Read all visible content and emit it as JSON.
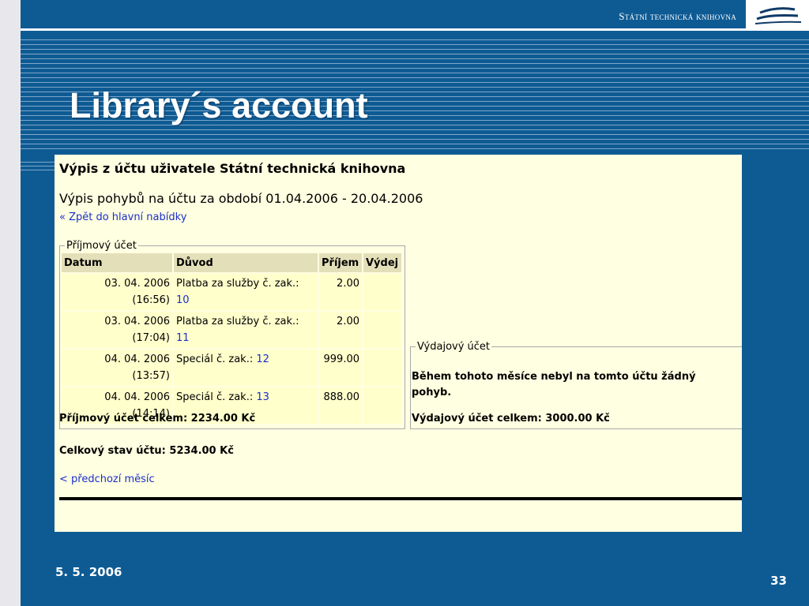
{
  "header": {
    "organization": "Státní technická knihovna",
    "logo": "stk-logo-icon"
  },
  "title": "Library´s account",
  "statement": {
    "heading": "Výpis z účtu uživatele Státní technická knihovna",
    "period": "Výpis pohybů na účtu za období 01.04.2006 - 20.04.2006",
    "back_link": "« Zpět do hlavní nabídky",
    "income": {
      "legend": "Příjmový účet",
      "columns": [
        "Datum",
        "Důvod",
        "Příjem",
        "Výdej"
      ],
      "rows": [
        {
          "date": "03. 04. 2006",
          "time": "(16:56)",
          "reason_line1": "Platba za služby č. zak.:",
          "reason_ref": "10",
          "income": "2.00",
          "expense": ""
        },
        {
          "date": "03. 04. 2006",
          "time": "(17:04)",
          "reason_line1": "Platba za služby č. zak.:",
          "reason_ref": "11",
          "income": "2.00",
          "expense": ""
        },
        {
          "date": "04. 04. 2006",
          "time": "(13:57)",
          "reason_line1": "Speciál č. zak.:",
          "reason_ref": "12",
          "income": "999.00",
          "expense": ""
        },
        {
          "date": "04. 04. 2006",
          "time": "(14:14)",
          "reason_line1": "Speciál č. zak.:",
          "reason_ref": "13",
          "income": "888.00",
          "expense": ""
        }
      ],
      "total": "Příjmový účet celkem: 2234.00 Kč"
    },
    "expense": {
      "legend": "Výdajový účet",
      "message": "Během tohoto měsíce nebyl na tomto účtu žádný pohyb.",
      "total": "Výdajový účet celkem: 3000.00 Kč"
    },
    "overall": "Celkový stav účtu: 5234.00 Kč",
    "prev_link": "< předchozí měsíc"
  },
  "footer": {
    "date": "5. 5. 2006",
    "page": "33"
  }
}
